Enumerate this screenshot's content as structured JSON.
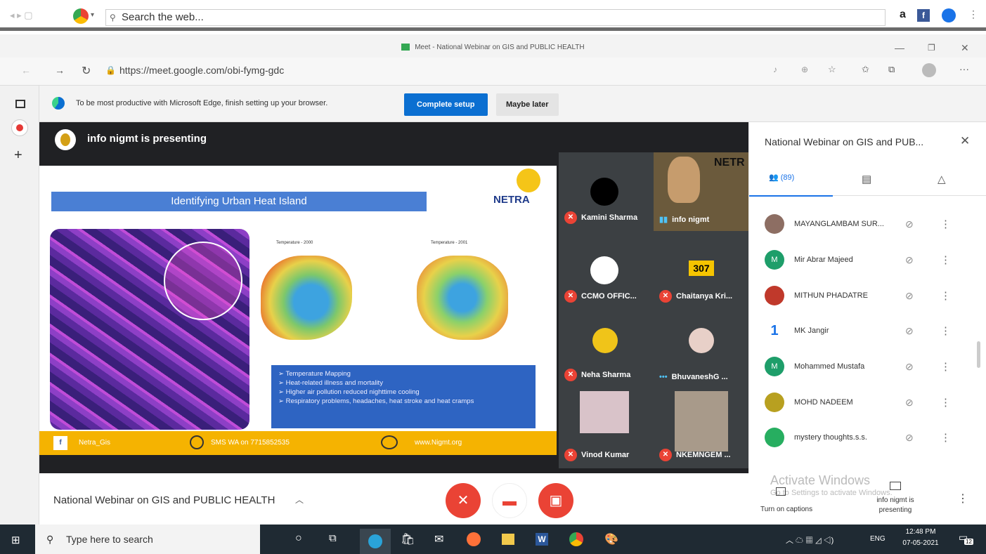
{
  "outer_browser": {
    "search_placeholder": "Search the web..."
  },
  "window": {
    "title": "Meet - National Webinar on GIS and PUBLIC HEALTH"
  },
  "address": {
    "url": "https://meet.google.com/obi-fymg-gdc"
  },
  "banner": {
    "message": "To be most productive with Microsoft Edge, finish setting up your browser.",
    "complete_label": "Complete setup",
    "later_label": "Maybe later"
  },
  "meet": {
    "presenting_text": "info nigmt is presenting",
    "slide": {
      "title": "Identifying Urban Heat Island",
      "logo": "NETRA",
      "map1_label": "Temperature - 2000",
      "map2_label": "Temperature - 2001",
      "bullets": [
        "Temperature Mapping",
        "Heat-related illness and mortality",
        "Higher air pollution reduced nighttime cooling",
        "Respiratory problems, headaches, heat stroke and heat cramps"
      ],
      "footer": [
        "Netra_Gis",
        "SMS WA on 7715852535",
        "www.Nigmt.org"
      ]
    },
    "tiles": [
      {
        "name": "Kamini Sharma",
        "color": "#000000"
      },
      {
        "name": "info nigmt",
        "color": "#6b5a3c"
      },
      {
        "name": "CCMO OFFIC...",
        "color": "#3c4043"
      },
      {
        "name": "Chaitanya Kri...",
        "color": "#3c4043",
        "badge": "307"
      },
      {
        "name": "Neha Sharma",
        "color": "#3c4043"
      },
      {
        "name": "BhuvaneshG ...",
        "color": "#3c4043"
      },
      {
        "name": "Vinod Kumar",
        "color": "#7b6a5a"
      },
      {
        "name": "NKEMNGEM ...",
        "color": "#6a5a4a"
      }
    ]
  },
  "panel": {
    "title": "National Webinar on GIS and PUB...",
    "people_count": "(89)",
    "people": [
      {
        "name": "MAYANGLAMBAM SUR...",
        "color": "#8d6e63",
        "initial": ""
      },
      {
        "name": "Mir Abrar Majeed",
        "color": "#1e9e6a",
        "initial": "M"
      },
      {
        "name": "MITHUN PHADATRE",
        "color": "#c0392b",
        "initial": ""
      },
      {
        "name": "MK Jangir",
        "color": "#ffffff",
        "initial": "1"
      },
      {
        "name": "Mohammed Mustafa",
        "color": "#1e9e6a",
        "initial": "M"
      },
      {
        "name": "MOHD NADEEM",
        "color": "#b8a020",
        "initial": ""
      },
      {
        "name": "mystery thoughts.s.s.",
        "color": "#27ae60",
        "initial": ""
      }
    ]
  },
  "bottom": {
    "meeting_title": "National Webinar on GIS and PUBLIC HEALTH",
    "captions_label": "Turn on captions",
    "presenting_label": "info nigmt is presenting",
    "watermark_line1": "Activate Windows",
    "watermark_line2": "Go to Settings to activate Windows."
  },
  "taskbar": {
    "search_placeholder": "Type here to search",
    "lang": "ENG",
    "time": "12:48 PM",
    "date": "07-05-2021",
    "notif_count": "12"
  },
  "colors": {
    "accent_blue": "#0b6fd1",
    "meet_red": "#ea4335",
    "meet_dark": "#202124",
    "slide_yellow": "#f5b301"
  }
}
